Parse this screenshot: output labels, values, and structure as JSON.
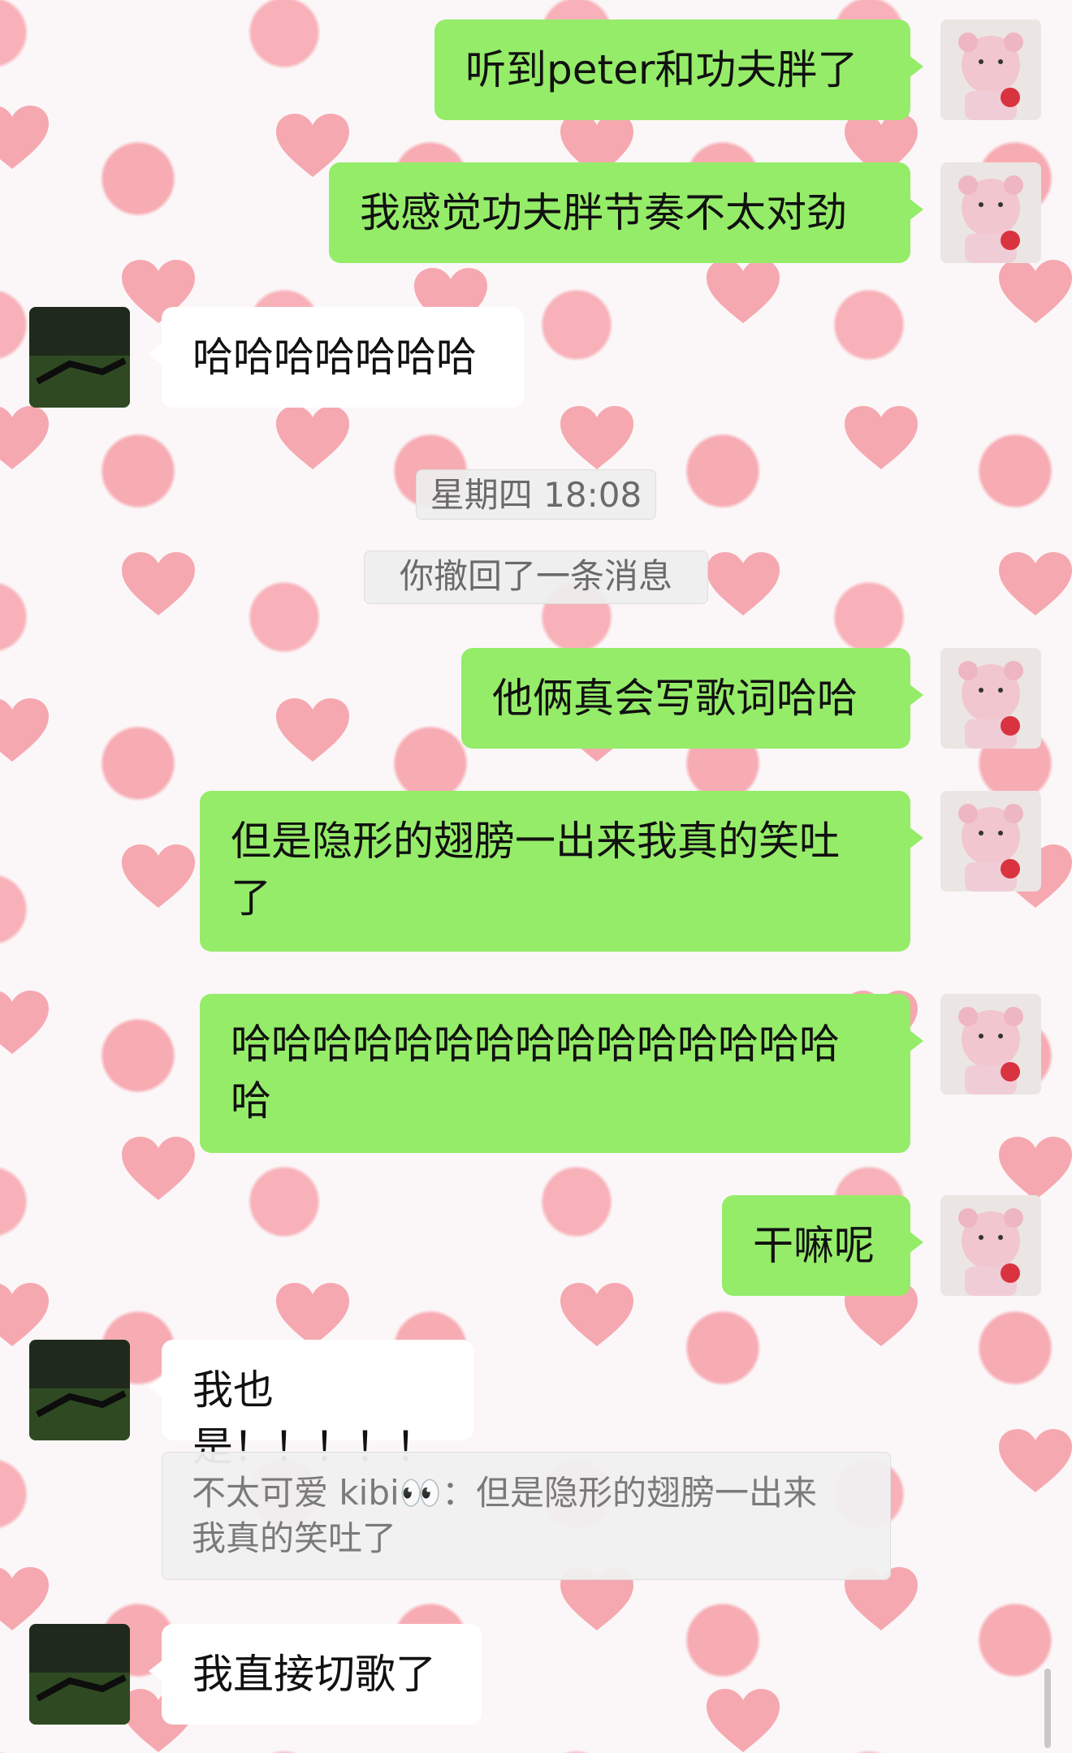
{
  "colors": {
    "outgoing_bubble": "#95ec69",
    "incoming_bubble": "#ffffff",
    "heart": "#f5959f",
    "system_text": "#6a6a6a"
  },
  "icons": {
    "self_avatar": "pink-teddy-bear-avatar",
    "other_avatar": "dark-grass-photo-avatar"
  },
  "messages": {
    "m1": "听到peter和功夫胖了",
    "m2": "我感觉功夫胖节奏不太对劲",
    "m3": "哈哈哈哈哈哈哈",
    "timestamp": "星期四 18:08",
    "recall_notice": "你撤回了一条消息",
    "m4": "他俩真会写歌词哈哈",
    "m5": "但是隐形的翅膀一出来我真的笑吐\n了",
    "m6": "哈哈哈哈哈哈哈哈哈哈哈哈哈哈哈\n哈",
    "m7": "干嘛呢",
    "m8": "我也是！！！！！",
    "quote": "不太可爱 kibi👀：但是隐形的翅膀一出来\n我真的笑吐了",
    "m9": "我直接切歌了"
  }
}
